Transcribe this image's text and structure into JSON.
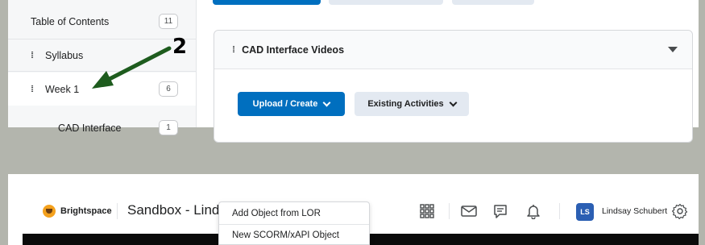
{
  "course_builder": {
    "sidebar": {
      "toc": {
        "label": "Table of Contents",
        "count": "11"
      },
      "syllabus": {
        "label": "Syllabus"
      },
      "week": {
        "label": "Week 1",
        "count": "6"
      },
      "sub": {
        "label": "CAD Interface",
        "count": "1"
      }
    },
    "annotation": {
      "number": "2",
      "color": "#1e5c1e"
    },
    "module": {
      "title": "CAD Interface Videos",
      "upload_label": "Upload / Create",
      "existing_label": "Existing Activities"
    }
  },
  "navbar": {
    "brand": "Brightspace",
    "course_title": "Sandbox - Lind",
    "user_initials": "LS",
    "user_name": "Lindsay Schubert",
    "dropdown_items": [
      "Add Object from LOR",
      "New SCORM/xAPI Object"
    ]
  },
  "colors": {
    "primary": "#006fbf",
    "secondary": "#e3e9f1",
    "avatar": "#2b5fb3"
  },
  "icons": [
    "drag-handle-icon",
    "caret-down-icon",
    "chevron-down-icon",
    "brightspace-logo-icon",
    "app-grid-icon",
    "mail-icon",
    "chat-icon",
    "bell-icon",
    "gear-icon"
  ]
}
